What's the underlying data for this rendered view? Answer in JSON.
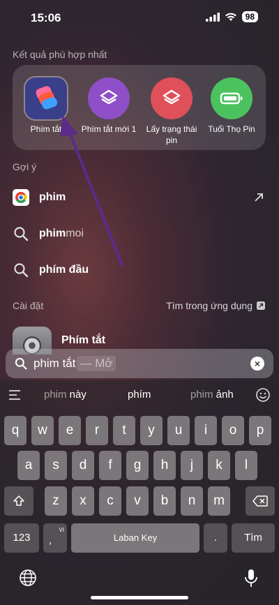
{
  "status_bar": {
    "time": "15:06",
    "battery": "98"
  },
  "top_hits": {
    "label": "Kết quả phù hợp nhất",
    "apps": [
      {
        "name": "Phím tắt",
        "color": "#3a3f8a"
      },
      {
        "name": "Phím tắt mới 1",
        "color": "#8e4fc9"
      },
      {
        "name": "Lấy trạng thái pin",
        "color": "#e0505a"
      },
      {
        "name": "Tuổi Thọ Pin",
        "color": "#4cc25f"
      }
    ]
  },
  "suggestions": {
    "label": "Gợi ý",
    "items": [
      {
        "bold": "phim",
        "rest": "",
        "icon": "chrome-icon"
      },
      {
        "bold": "phim",
        "rest": "moi",
        "icon": "search-icon"
      },
      {
        "bold": "phím đầu",
        "rest": "",
        "icon": "search-icon"
      }
    ]
  },
  "settings": {
    "label": "Cài đặt",
    "search_in_app": "Tìm trong ứng dụng",
    "item": "Phím tắt"
  },
  "search": {
    "query": "phim tắt",
    "hint": "— Mở"
  },
  "keyboard": {
    "predictions": [
      {
        "gray": "phim",
        "rest": " này"
      },
      {
        "gray": "",
        "rest": "phím"
      },
      {
        "gray": "phim",
        "rest": " ảnh"
      }
    ],
    "row1": [
      "q",
      "w",
      "e",
      "r",
      "t",
      "y",
      "u",
      "i",
      "o",
      "p"
    ],
    "row2": [
      "a",
      "s",
      "d",
      "f",
      "g",
      "h",
      "j",
      "k",
      "l"
    ],
    "row3": [
      "z",
      "x",
      "c",
      "v",
      "b",
      "n",
      "m"
    ],
    "numbers_key": "123",
    "vi_label": "VI",
    "space_label": "Laban Key",
    "period_key": ".",
    "return_key": "Tìm"
  }
}
